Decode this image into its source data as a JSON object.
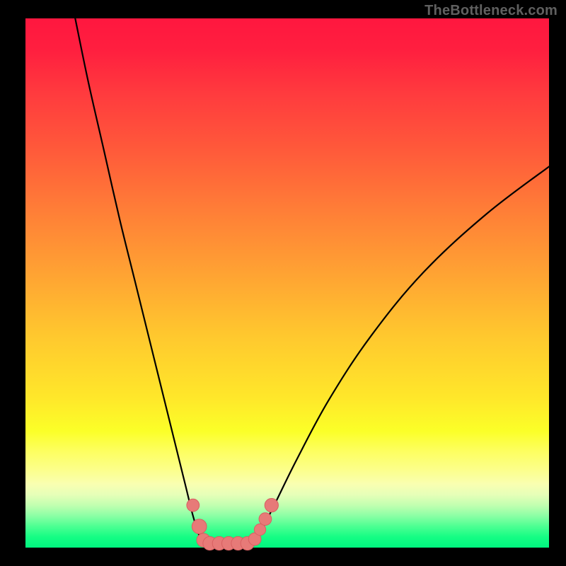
{
  "watermark": "TheBottleneck.com",
  "colors": {
    "page_bg": "#000000",
    "curve": "#000000",
    "marker_fill": "#e77a78",
    "marker_stroke": "#d86062",
    "gradient_top": "#ff173f",
    "gradient_bottom": "#00f57f"
  },
  "chart_data": {
    "type": "line",
    "title": "",
    "xlabel": "",
    "ylabel": "",
    "xlim": [
      0,
      100
    ],
    "ylim": [
      0,
      100
    ],
    "grid": false,
    "legend": false,
    "series": [
      {
        "name": "curve-left",
        "x": [
          9.5,
          12,
          15,
          18,
          21,
          24,
          27,
          30.5,
          32,
          33.3,
          34.3
        ],
        "values": [
          100,
          88,
          75,
          62,
          50,
          38,
          26,
          12,
          6,
          2,
          0.8
        ]
      },
      {
        "name": "curve-right",
        "x": [
          43.3,
          44.5,
          46,
          48,
          52,
          58,
          66,
          76,
          88,
          100
        ],
        "values": [
          0.8,
          2,
          5,
          9,
          17,
          28,
          40,
          52,
          63,
          72
        ]
      },
      {
        "name": "trough-flat",
        "x": [
          34.3,
          43.3
        ],
        "values": [
          0.8,
          0.8
        ]
      }
    ],
    "markers": [
      {
        "x": 32.0,
        "y": 8.0,
        "r": 1.2
      },
      {
        "x": 33.2,
        "y": 4.0,
        "r": 1.4
      },
      {
        "x": 34.0,
        "y": 1.4,
        "r": 1.3
      },
      {
        "x": 35.2,
        "y": 0.8,
        "r": 1.3
      },
      {
        "x": 37.0,
        "y": 0.8,
        "r": 1.3
      },
      {
        "x": 38.8,
        "y": 0.8,
        "r": 1.3
      },
      {
        "x": 40.6,
        "y": 0.8,
        "r": 1.3
      },
      {
        "x": 42.4,
        "y": 0.8,
        "r": 1.3
      },
      {
        "x": 43.8,
        "y": 1.6,
        "r": 1.2
      },
      {
        "x": 44.8,
        "y": 3.4,
        "r": 1.1
      },
      {
        "x": 45.8,
        "y": 5.4,
        "r": 1.2
      },
      {
        "x": 47.0,
        "y": 8.0,
        "r": 1.3
      }
    ]
  }
}
